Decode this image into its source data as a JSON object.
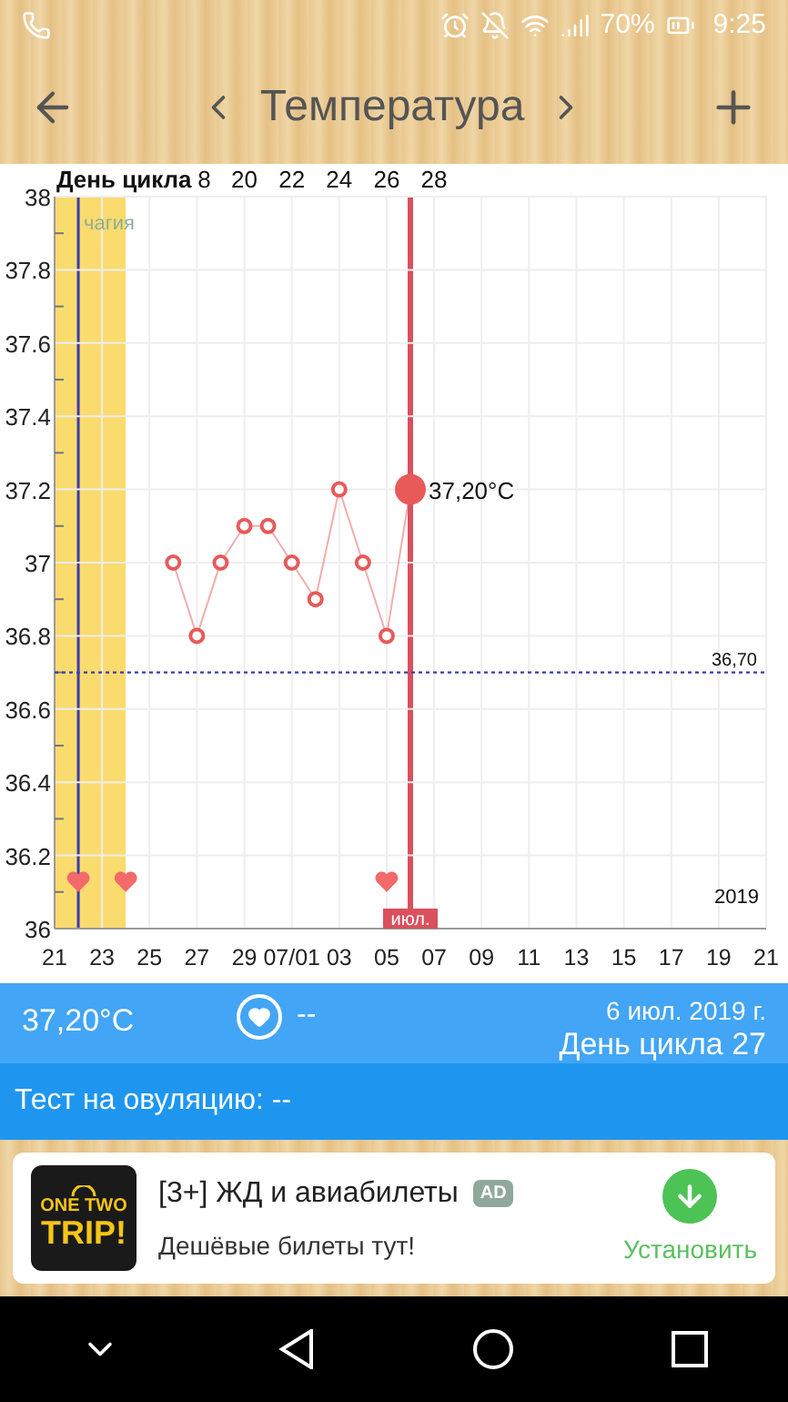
{
  "status_bar": {
    "battery": "70%",
    "time": "9:25"
  },
  "header": {
    "title": "Температура"
  },
  "chart": {
    "cycle_day_axis": {
      "title": "День цикла",
      "ticks": [
        "8",
        "20",
        "22",
        "24",
        "26",
        "28"
      ]
    },
    "chart_data": {
      "type": "line",
      "categories": [
        "21",
        null,
        "23",
        null,
        "25",
        null,
        "27",
        null,
        "29",
        null,
        "07/01",
        null,
        "03",
        null,
        "05",
        null,
        "07",
        null,
        "09",
        null,
        "11",
        null,
        "13",
        null,
        "15",
        null,
        "17",
        null,
        "19",
        null,
        "21"
      ],
      "grid": true,
      "series": [
        {
          "marker": "circle",
          "color": "#e85a5a",
          "values": [
            null,
            null,
            null,
            null,
            null,
            37.0,
            36.8,
            37.0,
            37.1,
            37.1,
            37.0,
            36.9,
            37.2,
            37.0,
            36.8,
            37.2,
            null,
            null,
            null,
            null,
            null,
            null,
            null,
            null,
            null,
            null,
            null,
            null,
            null,
            null,
            null
          ]
        },
        {
          "type": "scatter",
          "color": "#f26a6a",
          "values": [
            null,
            36.13,
            null,
            36.13,
            null,
            null,
            null,
            null,
            null,
            null,
            null,
            null,
            null,
            null,
            36.13,
            null,
            null,
            null,
            null,
            null,
            null,
            null,
            null,
            null,
            null,
            null,
            null,
            null,
            null,
            null,
            null
          ]
        }
      ],
      "ylim": [
        36,
        38
      ],
      "yticks": [
        36,
        36.2,
        36.4,
        36.6,
        36.8,
        37,
        37.2,
        37.4,
        37.6,
        37.8,
        38
      ],
      "ref_lines": [
        {
          "axis": "y",
          "value": 36.7,
          "label": "36,70",
          "color": "#3b3bb0"
        }
      ]
    },
    "band_label": "чагия",
    "selected_value": "37,20°C",
    "month_marker": "июл.",
    "year_label": "2019"
  },
  "info": {
    "temperature": "37,20°C",
    "sex": "--",
    "date": "6 июл. 2019 г.",
    "cycle_day": "День цикла 27"
  },
  "ovulation_test": "Тест на овуляцию: --",
  "ad": {
    "logo_top": "ONE TWO",
    "logo_bottom": "TRIP!",
    "title": "[3+] ЖД и авиабилеты",
    "badge": "AD",
    "subtitle": "Дешёвые билеты тут!",
    "action": "Установить"
  }
}
